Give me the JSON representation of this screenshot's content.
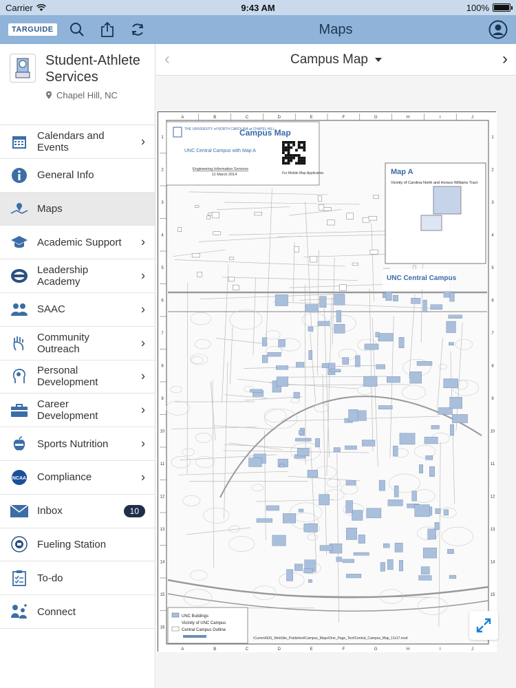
{
  "status": {
    "carrier": "Carrier",
    "time": "9:43 AM",
    "battery": "100%"
  },
  "header": {
    "logo": "TARGUIDE",
    "title": "Maps"
  },
  "org": {
    "name": "Student-Athlete Services",
    "location": "Chapel Hill, NC"
  },
  "menu": [
    {
      "label": "Calendars and Events",
      "icon": "calendar-icon",
      "chevron": true
    },
    {
      "label": "General Info",
      "icon": "info-icon",
      "chevron": false
    },
    {
      "label": "Maps",
      "icon": "map-icon",
      "chevron": false,
      "active": true
    },
    {
      "label": "Academic Support",
      "icon": "graduation-cap-icon",
      "chevron": true
    },
    {
      "label": "Leadership Academy",
      "icon": "leadership-badge-icon",
      "chevron": true
    },
    {
      "label": "SAAC",
      "icon": "group-icon",
      "chevron": true
    },
    {
      "label": "Community Outreach",
      "icon": "hand-icon",
      "chevron": true
    },
    {
      "label": "Personal Development",
      "icon": "head-icon",
      "chevron": true
    },
    {
      "label": "Career Development",
      "icon": "briefcase-icon",
      "chevron": true
    },
    {
      "label": "Sports Nutrition",
      "icon": "apple-icon",
      "chevron": true
    },
    {
      "label": "Compliance",
      "icon": "ncaa-icon",
      "chevron": true
    },
    {
      "label": "Inbox",
      "icon": "mail-icon",
      "badge": "10"
    },
    {
      "label": "Fueling Station",
      "icon": "fueling-icon",
      "chevron": false
    },
    {
      "label": "To-do",
      "icon": "checklist-icon",
      "chevron": false
    },
    {
      "label": "Connect",
      "icon": "connect-icon",
      "chevron": false
    }
  ],
  "map": {
    "title": "Campus Map",
    "inset_title": "Campus Map",
    "university": "THE UNIVERSITY of NORTH CAROLINA at CHAPEL HILL",
    "subtitle": "UNC Central Campus with Map A",
    "org": "Engineering Information Services",
    "date": "11 March 2014",
    "qr_label": "For Mobile Map Application",
    "map_a_title": "Map A",
    "map_a_sub": "Vicinity of Carolina North and Horace Williams Tract",
    "central_label": "UNC Central Campus",
    "legend": [
      "UNC Buildings",
      "Vicinity of UNC Campus",
      "Central Campus Outline"
    ],
    "path": "\\Current\\EIS_WebSite_Published\\Campus_Maps\\One_Page_Text\\Central_Campus_Map_11x17.mxd",
    "col_labels": [
      "A",
      "B",
      "C",
      "D",
      "E",
      "F",
      "G",
      "H",
      "I",
      "J"
    ],
    "row_labels": [
      "1",
      "2",
      "3",
      "4",
      "5",
      "6",
      "7",
      "8",
      "9",
      "10",
      "11",
      "12",
      "13",
      "14",
      "15",
      "16"
    ]
  },
  "colors": {
    "header": "#8fb3d9",
    "status": "#c8daec",
    "building": "#a9bfdc",
    "badge": "#1f2f4a"
  }
}
